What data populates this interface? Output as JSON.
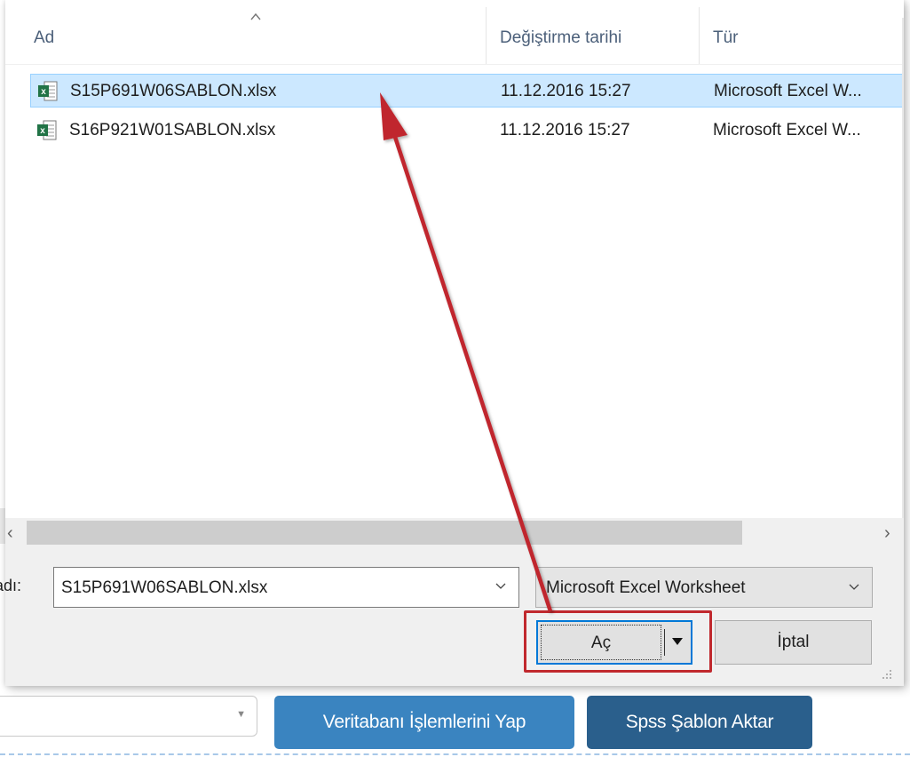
{
  "columns": {
    "name": "Ad",
    "date": "Değiştirme tarihi",
    "type": "Tür"
  },
  "files": [
    {
      "name": "S15P691W06SABLON.xlsx",
      "date": "11.12.2016 15:27",
      "type": "Microsoft Excel W...",
      "icon": "excel-file-icon",
      "selected": true
    },
    {
      "name": "S16P921W01SABLON.xlsx",
      "date": "11.12.2016 15:27",
      "type": "Microsoft Excel W...",
      "icon": "excel-file-icon",
      "selected": false
    }
  ],
  "footer": {
    "filename_label": "adı:",
    "filename_value": "S15P691W06SABLON.xlsx",
    "filetype_value": "Microsoft Excel Worksheet",
    "open_label": "Aç",
    "cancel_label": "İptal"
  },
  "background_app": {
    "db_button": "Veritabanı İşlemlerini Yap",
    "spss_button": "Spss Şablon Aktar"
  },
  "colors": {
    "selection": "#cce8ff",
    "annotation": "#c0282d",
    "db_button": "#3a84c0",
    "spss_button": "#2a5f8c"
  }
}
